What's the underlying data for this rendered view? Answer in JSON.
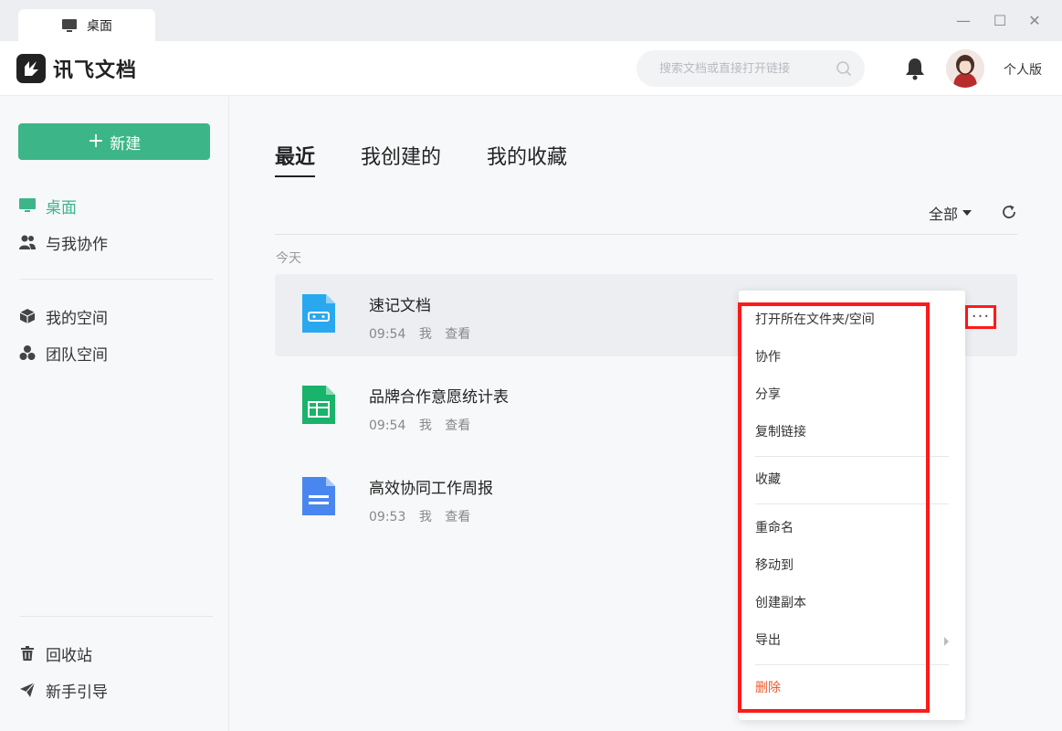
{
  "window": {
    "tab_label": "桌面",
    "minimize_glyph": "—",
    "maximize_glyph": "☐",
    "close_glyph": "✕"
  },
  "header": {
    "app_name": "讯飞文档",
    "search_placeholder": "搜索文档或直接打开链接",
    "edition_label": "个人版"
  },
  "sidebar": {
    "new_label": "新建",
    "new_plus": "+",
    "items": [
      {
        "label": "桌面",
        "icon": "desktop-icon",
        "active": true
      },
      {
        "label": "与我协作",
        "icon": "users-icon"
      },
      {
        "label": "我的空间",
        "icon": "cube-icon"
      },
      {
        "label": "团队空间",
        "icon": "team-icon"
      }
    ],
    "bottom_items": [
      {
        "label": "回收站",
        "icon": "trash-icon"
      },
      {
        "label": "新手引导",
        "icon": "paper-plane-icon"
      }
    ],
    "accent_color": "#3cb588"
  },
  "main": {
    "tabs": [
      {
        "label": "最近",
        "active": true
      },
      {
        "label": "我创建的"
      },
      {
        "label": "我的收藏"
      }
    ],
    "filter_label": "全部",
    "group_label": "今天",
    "files": [
      {
        "name": "速记文档",
        "time": "09:54",
        "owner": "我",
        "action": "查看",
        "icon": "memo-doc-icon",
        "color": "#29a8f0"
      },
      {
        "name": "品牌合作意愿统计表",
        "time": "09:54",
        "owner": "我",
        "action": "查看",
        "icon": "spreadsheet-icon",
        "color": "#19b36b"
      },
      {
        "name": "高效协同工作周报",
        "time": "09:53",
        "owner": "我",
        "action": "查看",
        "icon": "document-icon",
        "color": "#4a86f0"
      }
    ],
    "more_glyph": "···"
  },
  "context_menu": {
    "items": [
      {
        "label": "打开所在文件夹/空间"
      },
      {
        "label": "协作"
      },
      {
        "label": "分享"
      },
      {
        "label": "复制链接"
      },
      {
        "label": "收藏"
      },
      {
        "label": "重命名"
      },
      {
        "label": "移动到"
      },
      {
        "label": "创建副本"
      },
      {
        "label": "导出",
        "has_submenu": true
      },
      {
        "label": "删除",
        "danger": true
      }
    ],
    "danger_color": "#ee5a2e"
  }
}
